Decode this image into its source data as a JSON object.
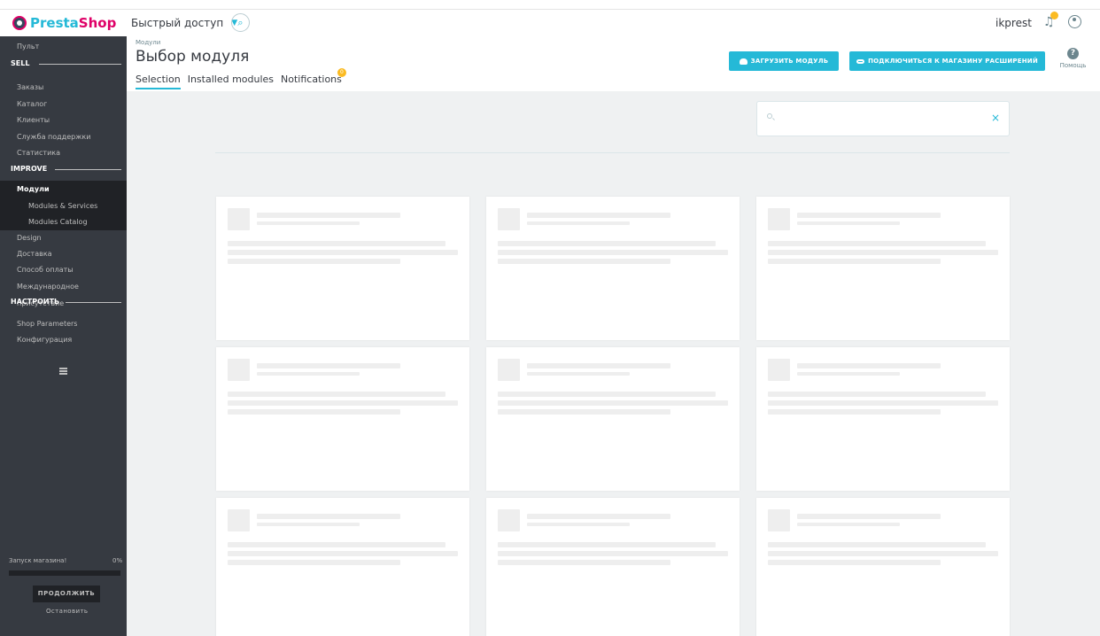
{
  "header": {
    "logo_pre": "Presta",
    "logo_shop": "Shop",
    "quick_access": "Быстрый доступ",
    "user_name": "ikprest"
  },
  "sidebar": {
    "items": [
      {
        "kind": "item",
        "label": "Пульт"
      },
      {
        "kind": "section",
        "label": "SELL"
      },
      {
        "kind": "item",
        "label": "Заказы"
      },
      {
        "kind": "item",
        "label": "Каталог"
      },
      {
        "kind": "item",
        "label": "Клиенты"
      },
      {
        "kind": "item",
        "label": "Служба поддержки"
      },
      {
        "kind": "item",
        "label": "Статистика"
      },
      {
        "kind": "section",
        "label": "IMPROVE"
      },
      {
        "kind": "active",
        "label": "Модули"
      },
      {
        "kind": "sub",
        "label": "Modules & Services"
      },
      {
        "kind": "sub",
        "label": "Modules Catalog"
      },
      {
        "kind": "item",
        "label": "Design"
      },
      {
        "kind": "item",
        "label": "Доставка"
      },
      {
        "kind": "item",
        "label": "Способ оплаты"
      },
      {
        "kind": "item",
        "label": "Международное присутствие"
      },
      {
        "kind": "section",
        "label": "НАСТРОИТЬ"
      },
      {
        "kind": "item",
        "label": "Shop Parameters"
      },
      {
        "kind": "item",
        "label": "Конфигурация"
      }
    ],
    "onboarding": {
      "label": "Запуск магазина!",
      "percent": "0%",
      "progress": 0,
      "continue": "ПРОДОЛЖИТЬ",
      "stop": "Остановить"
    }
  },
  "page": {
    "breadcrumb": "Модули",
    "title": "Выбор модуля",
    "tabs": [
      {
        "label": "Selection",
        "active": true
      },
      {
        "label": "Installed modules",
        "active": false
      },
      {
        "label": "Notifications",
        "active": false,
        "badge": "0"
      }
    ],
    "upload_button": "ЗАГРУЗИТЬ МОДУЛЬ",
    "connect_button": "ПОДКЛЮЧИТЬСЯ К МАГАЗИНУ РАСШИРЕНИЙ",
    "help_label": "Помощь"
  },
  "search": {
    "value": "",
    "placeholder": ""
  },
  "colors": {
    "accent": "#25b9d7",
    "brand_pink": "#df0067",
    "sidebar_bg": "#363a41",
    "badge": "#fbbb22"
  },
  "icons": {
    "quick_search": "search-icon",
    "notifications": "bell-icon",
    "user": "user-icon",
    "help": "question-icon",
    "upload": "cloud-upload-icon",
    "connect": "key-icon"
  }
}
